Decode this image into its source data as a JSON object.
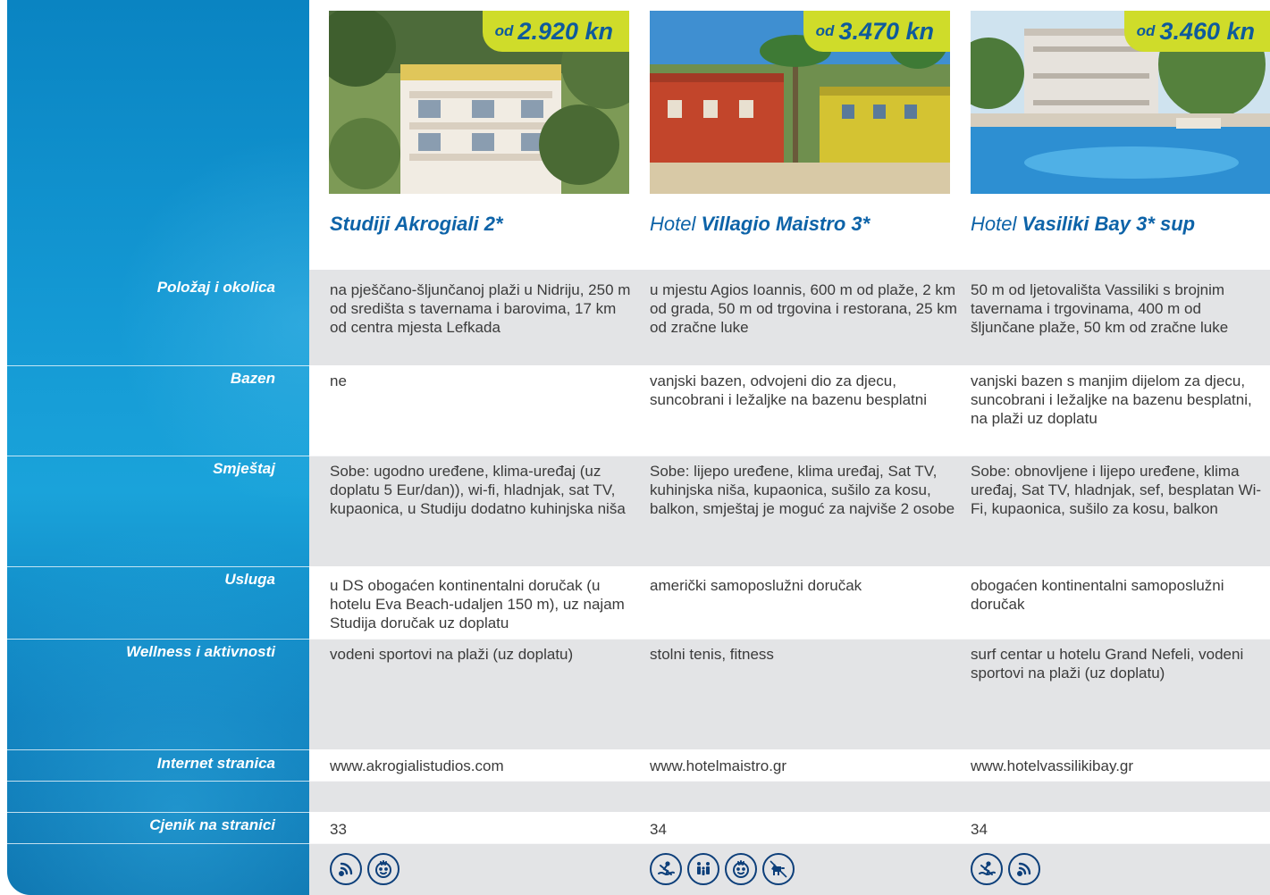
{
  "labels": {
    "polozaj": "Položaj i okolica",
    "bazen": "Bazen",
    "smjestaj": "Smještaj",
    "usluga": "Usluga",
    "wellness": "Wellness i aktivnosti",
    "internet": "Internet stranica",
    "cjenik": "Cjenik na stranici"
  },
  "hotels": [
    {
      "price_prefix": "od",
      "price": "2.920 kn",
      "kind": "",
      "name": "Studiji Akrogiali 2*",
      "polozaj": "na pješčano-šljunčanoj plaži u Nidriju, 250 m od središta s tavernama i barovima, 17 km od centra mjesta Lefkada",
      "bazen": "ne",
      "smjestaj": "Sobe: ugodno uređene, klima-uređaj (uz doplatu 5 Eur/dan)), wi-fi, hladnjak, sat TV, kupaonica, u Studiju dodatno kuhinjska niša",
      "usluga": "u DS obogaćen kontinentalni doručak (u hotelu Eva Beach-udaljen 150 m), uz najam Studija doručak uz doplatu",
      "wellness": "vodeni sportovi na plaži (uz doplatu)",
      "internet": "www.akrogialistudios.com",
      "cjenik": "33",
      "icons": [
        "wifi-icon",
        "child-friendly-icon"
      ]
    },
    {
      "price_prefix": "od",
      "price": "3.470 kn",
      "kind": "Hotel",
      "name": "Villagio Maistro 3*",
      "polozaj": "u mjestu Agios Ioannis, 600 m od plaže, 2 km od grada, 50 m od trgovina i restorana, 25 km od zračne luke",
      "bazen": "vanjski bazen, odvojeni dio za djecu, suncobrani i ležaljke na bazenu besplatni",
      "smjestaj": "Sobe: lijepo uređene, klima uređaj, Sat TV, kuhinjska niša, kupaonica, sušilo za kosu, balkon, smještaj je moguć za najviše 2 osobe",
      "usluga": "američki samoposlužni doručak",
      "wellness": "stolni tenis, fitness",
      "internet": "www.hotelmaistro.gr",
      "cjenik": "34",
      "icons": [
        "water-sports-icon",
        "family-icon",
        "child-friendly-icon",
        "pet-friendly-icon"
      ]
    },
    {
      "price_prefix": "od",
      "price": "3.460 kn",
      "kind": "Hotel",
      "name": "Vasiliki Bay 3* sup",
      "polozaj": "50 m od ljetovališta Vassiliki s brojnim tavernama i trgovinama, 400 m od šljunčane plaže, 50 km od zračne luke",
      "bazen": "vanjski bazen s manjim dijelom za djecu, suncobrani i ležaljke na bazenu besplatni, na plaži uz doplatu",
      "smjestaj": "Sobe: obnovljene i lijepo uređene, klima uređaj, Sat TV, hladnjak, sef, besplatan Wi-Fi, kupaonica, sušilo za kosu, balkon",
      "usluga": "obogaćen kontinentalni samoposlužni doručak",
      "wellness": "surf centar u hotelu Grand Nefeli, vodeni sportovi na plaži (uz doplatu)",
      "internet": "www.hotelvassilikibay.gr",
      "cjenik": "34",
      "icons": [
        "water-sports-icon",
        "wifi-icon"
      ]
    }
  ]
}
